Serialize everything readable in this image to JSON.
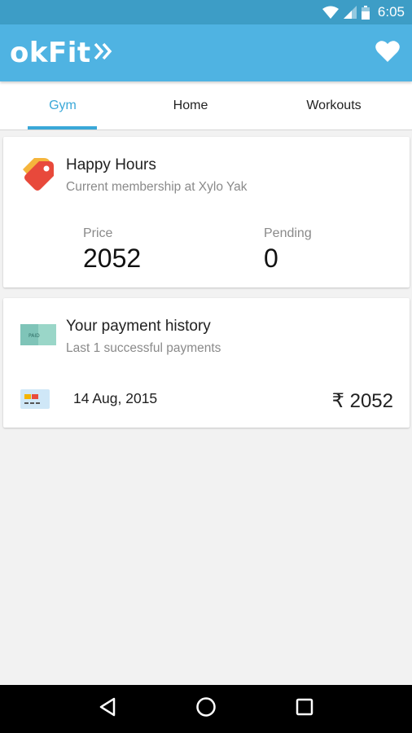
{
  "status_bar": {
    "time": "6:05",
    "icons": [
      "wifi-icon",
      "signal-icon",
      "battery-icon"
    ],
    "background": "#3d9dc6"
  },
  "app_bar": {
    "logo_text": "okFit",
    "background": "#4fb3e2",
    "action_icon": "heart-icon"
  },
  "tabs": [
    {
      "label": "Gym",
      "active": true
    },
    {
      "label": "Home",
      "active": false
    },
    {
      "label": "Workouts",
      "active": false
    }
  ],
  "accent_color": "#3aa8d8",
  "membership": {
    "title": "Happy Hours",
    "subtitle": "Current membership at Xylo Yak",
    "icon": "price-tag-icon",
    "price_label": "Price",
    "price_value": "2052",
    "pending_label": "Pending",
    "pending_value": "0"
  },
  "payments": {
    "title": "Your payment history",
    "subtitle": "Last 1 successful payments",
    "icon": "paid-receipt-icon",
    "items": [
      {
        "date": "14 Aug, 2015",
        "amount": "₹ 2052",
        "icon": "credit-card-icon"
      }
    ]
  },
  "nav_bar": {
    "buttons": [
      "back-icon",
      "home-icon",
      "recents-icon"
    ]
  }
}
